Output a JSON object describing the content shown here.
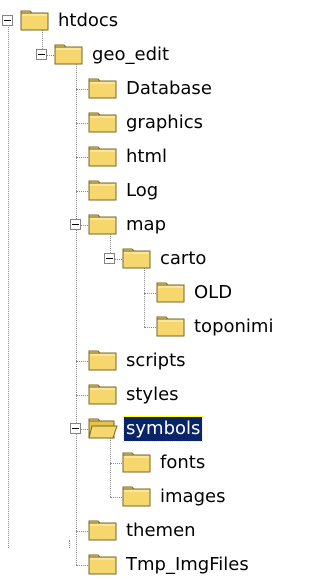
{
  "tree": {
    "nodes": [
      {
        "label": "htdocs",
        "depth": 0,
        "expandable": true,
        "expanded": true,
        "selected": false,
        "icon": "folder-icon"
      },
      {
        "label": "geo_edit",
        "depth": 1,
        "expandable": true,
        "expanded": true,
        "selected": false,
        "icon": "folder-icon"
      },
      {
        "label": "Database",
        "depth": 2,
        "expandable": false,
        "expanded": false,
        "selected": false,
        "icon": "folder-icon"
      },
      {
        "label": "graphics",
        "depth": 2,
        "expandable": false,
        "expanded": false,
        "selected": false,
        "icon": "folder-icon"
      },
      {
        "label": "html",
        "depth": 2,
        "expandable": false,
        "expanded": false,
        "selected": false,
        "icon": "folder-icon"
      },
      {
        "label": "Log",
        "depth": 2,
        "expandable": false,
        "expanded": false,
        "selected": false,
        "icon": "folder-icon"
      },
      {
        "label": "map",
        "depth": 2,
        "expandable": true,
        "expanded": true,
        "selected": false,
        "icon": "folder-icon"
      },
      {
        "label": "carto",
        "depth": 3,
        "expandable": true,
        "expanded": true,
        "selected": false,
        "icon": "folder-icon"
      },
      {
        "label": "OLD",
        "depth": 4,
        "expandable": false,
        "expanded": false,
        "selected": false,
        "icon": "folder-icon"
      },
      {
        "label": "toponimi",
        "depth": 4,
        "expandable": false,
        "expanded": false,
        "selected": false,
        "icon": "folder-icon"
      },
      {
        "label": "scripts",
        "depth": 2,
        "expandable": false,
        "expanded": false,
        "selected": false,
        "icon": "folder-icon"
      },
      {
        "label": "styles",
        "depth": 2,
        "expandable": false,
        "expanded": false,
        "selected": false,
        "icon": "folder-icon"
      },
      {
        "label": "symbols",
        "depth": 2,
        "expandable": true,
        "expanded": true,
        "selected": true,
        "icon": "open-folder-icon"
      },
      {
        "label": "fonts",
        "depth": 3,
        "expandable": false,
        "expanded": false,
        "selected": false,
        "icon": "folder-icon"
      },
      {
        "label": "images",
        "depth": 3,
        "expandable": false,
        "expanded": false,
        "selected": false,
        "icon": "folder-icon"
      },
      {
        "label": "themen",
        "depth": 2,
        "expandable": false,
        "expanded": false,
        "selected": false,
        "icon": "folder-icon"
      },
      {
        "label": "Tmp_ImgFiles",
        "depth": 2,
        "expandable": false,
        "expanded": false,
        "selected": false,
        "icon": "folder-icon"
      }
    ]
  },
  "colors": {
    "selection_background": "#0a246a",
    "selection_text": "#ffffff",
    "folder_fill": "#f5d76e",
    "folder_outline": "#7a6a20",
    "guide_line": "#8c8c8c"
  }
}
